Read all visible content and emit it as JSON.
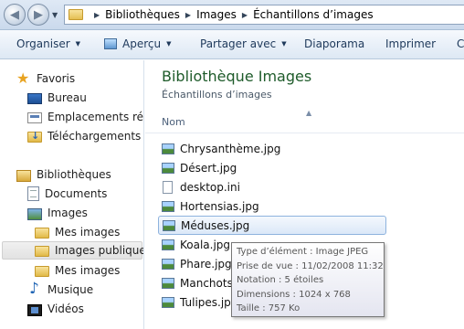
{
  "address": {
    "crumbs": [
      "Bibliothèques",
      "Images",
      "Échantillons d’images"
    ]
  },
  "toolbar": {
    "organize": "Organiser",
    "preview": "Aperçu",
    "share": "Partager avec",
    "slideshow": "Diaporama",
    "print": "Imprimer",
    "overflow": "C"
  },
  "nav": {
    "favorites": "Favoris",
    "desktop": "Bureau",
    "recent_places": "Emplacements récen",
    "downloads": "Téléchargements",
    "libraries": "Bibliothèques",
    "documents": "Documents",
    "images": "Images",
    "my_pictures": "Mes images",
    "public_pictures": "Images publiques",
    "my_pictures_2": "Mes images",
    "music": "Musique",
    "videos": "Vidéos"
  },
  "main": {
    "title": "Bibliothèque Images",
    "subtitle": "Échantillons d’images",
    "column_name": "Nom",
    "files": [
      {
        "name": "Chrysanthème.jpg",
        "type": "jpg"
      },
      {
        "name": "Désert.jpg",
        "type": "jpg"
      },
      {
        "name": "desktop.ini",
        "type": "ini"
      },
      {
        "name": "Hortensias.jpg",
        "type": "jpg"
      },
      {
        "name": "Méduses.jpg",
        "type": "jpg"
      },
      {
        "name": "Koala.jpg",
        "type": "jpg"
      },
      {
        "name": "Phare.jpg",
        "type": "jpg"
      },
      {
        "name": "Manchots",
        "type": "jpg"
      },
      {
        "name": "Tulipes.jpg",
        "type": "jpg"
      }
    ]
  },
  "tooltip": {
    "type": "Type d’élément : Image JPEG",
    "date": "Prise de vue : 11/02/2008 11:32",
    "rating": "Notation : 5 étoiles",
    "dimensions": "Dimensions : 1024 x 768",
    "size": "Taille : 757 Ko"
  },
  "colors": {
    "title": "#1e5b2a",
    "selection_border": "#8eb3de",
    "toolbar_text": "#1e395b"
  }
}
